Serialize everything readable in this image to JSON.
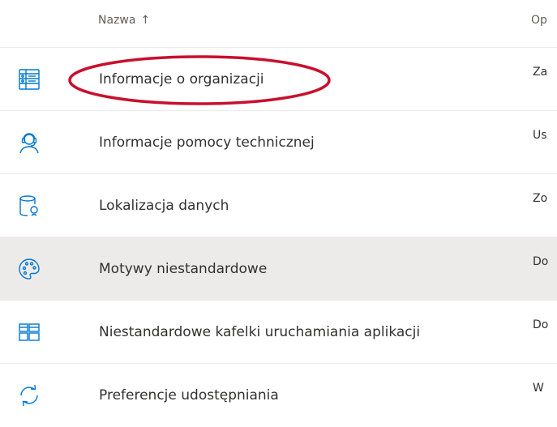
{
  "header": {
    "name_col": "Nazwa",
    "sort_icon": "arrow-up-icon",
    "desc_col": "Op"
  },
  "rows": [
    {
      "icon": "org-info-icon",
      "label": "Informacje o organizacji",
      "desc": "Za"
    },
    {
      "icon": "support-agent-icon",
      "label": "Informacje pomocy technicznej",
      "desc": "Us"
    },
    {
      "icon": "data-location-icon",
      "label": "Lokalizacja danych",
      "desc": "Zo"
    },
    {
      "icon": "palette-icon",
      "label": "Motywy niestandardowe",
      "desc": "Do"
    },
    {
      "icon": "app-tiles-icon",
      "label": "Niestandardowe kafelki uruchamiania aplikacji",
      "desc": "Do"
    },
    {
      "icon": "sync-icon",
      "label": "Preferencje udostępniania",
      "desc": "W"
    }
  ],
  "colors": {
    "accent": "#0078d4",
    "selected_row": "#edebe9",
    "annotation": "#c8102e"
  }
}
